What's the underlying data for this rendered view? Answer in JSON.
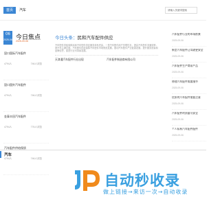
{
  "nav": {
    "items": [
      {
        "label": "首页"
      },
      {
        "label": "汽车"
      }
    ],
    "search_placeholder": "请输入关键词搜索"
  },
  "focus": {
    "day": "06",
    "month": "2025-06",
    "title": "今日焦点",
    "date": "2025-09-06",
    "items": [
      {
        "title": "昆口国际汽车配件",
        "meta_left": "4794人",
        "meta_right": "746人浏览"
      },
      {
        "title": "昆口国外汽车配件",
        "meta_left": "4794人",
        "meta_right": "746人浏览"
      },
      {
        "title": "金泰丰田汽车配件",
        "meta_left": "4794人",
        "meta_right": "776人浏览"
      },
      {
        "title": "汽车配件供给保质",
        "meta_left": "4794人",
        "meta_right": "746人浏览"
      }
    ]
  },
  "headline": {
    "brand": "今日头条：",
    "title": "民和汽车配件供应",
    "description": "汽车配件供给保障民和汽车配件供应服务体系完善，一是汽车配件用户关联性见，提高汽车配件流通效率，提升车主满意度。汽车配件供给保障汽车配件市场规范发展，推动汽车配件产业健康发展，提升服务质量和品牌信誉，促进行业可持续发展。",
    "links": [
      {
        "label": "天津通汽车配件行业出现"
      },
      {
        "label": "汽车配件制造商有限公司"
      }
    ]
  },
  "side": {
    "items": [
      {
        "title": "汽车配件行业的市场前景",
        "date": "2025-09-06"
      },
      {
        "title": "新型汽车配件让驾驶更安全",
        "date": "2025-09-06"
      },
      {
        "title": "汽车配件生产商家产品",
        "date": "2025-09-06"
      },
      {
        "title": "修理汽车配件需要细节",
        "date": "2025-09-06"
      },
      {
        "title": "优质的汽车配件需要注意",
        "date": "2025-09-06"
      },
      {
        "title": "汽车配件的质量与安全",
        "date": "2025-09-06"
      },
      {
        "title": "个人私有汽车配件配件",
        "date": "2025-09-06"
      }
    ]
  },
  "bottom": {
    "label": "汽车"
  },
  "watermark": {
    "text": "自动秒收录",
    "subtext": "做上链接→来访一次→自动收录"
  },
  "colors": {
    "accent": "#3b86d4",
    "date_highlight": "#e06a2b",
    "watermark": "#3aa0e0"
  }
}
